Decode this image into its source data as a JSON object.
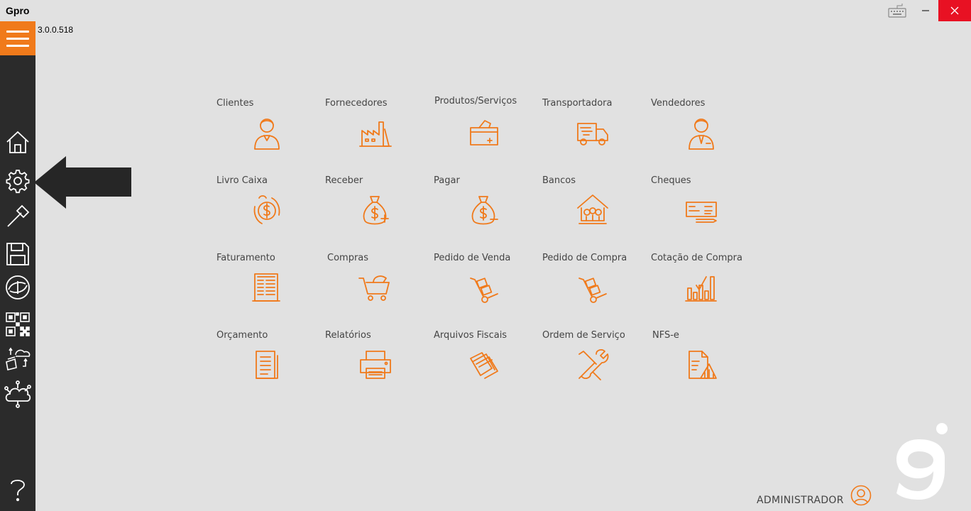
{
  "window": {
    "title": "Gpro",
    "version": "3.0.0.518"
  },
  "sidebar": {
    "items": [
      {
        "name": "home-icon"
      },
      {
        "name": "gear-icon"
      },
      {
        "name": "hammer-icon"
      },
      {
        "name": "save-icon"
      },
      {
        "name": "sync-logo-icon"
      },
      {
        "name": "qr-code-icon"
      },
      {
        "name": "cloud-sync-icon"
      },
      {
        "name": "cloud-network-icon"
      },
      {
        "name": "help-icon"
      }
    ]
  },
  "modules": [
    {
      "label": "Clientes",
      "icon": "person-icon"
    },
    {
      "label": "Fornecedores",
      "icon": "factory-icon"
    },
    {
      "label": "Produtos/Serviços",
      "icon": "box-icon"
    },
    {
      "label": "Transportadora",
      "icon": "truck-icon"
    },
    {
      "label": "Vendedores",
      "icon": "salesperson-icon"
    },
    {
      "label": "Livro Caixa",
      "icon": "cash-cycle-icon"
    },
    {
      "label": "Receber",
      "icon": "money-bag-plus-icon"
    },
    {
      "label": "Pagar",
      "icon": "money-bag-minus-icon"
    },
    {
      "label": "Bancos",
      "icon": "bank-icon"
    },
    {
      "label": "Cheques",
      "icon": "check-icon"
    },
    {
      "label": "Faturamento",
      "icon": "invoice-icon"
    },
    {
      "label": "Compras",
      "icon": "shopping-cart-icon"
    },
    {
      "label": "Pedido de Venda",
      "icon": "hand-truck-icon"
    },
    {
      "label": "Pedido de Compra",
      "icon": "hand-truck-icon"
    },
    {
      "label": "Cotação de Compra",
      "icon": "bar-chart-check-icon"
    },
    {
      "label": "Orçamento",
      "icon": "document-list-icon"
    },
    {
      "label": "Relatórios",
      "icon": "printer-icon"
    },
    {
      "label": "Arquivos Fiscais",
      "icon": "files-icon"
    },
    {
      "label": "Ordem de Serviço",
      "icon": "tools-icon"
    },
    {
      "label": "NFS-e",
      "icon": "document-chart-icon"
    }
  ],
  "user": {
    "name": "ADMINISTRADOR"
  },
  "colors": {
    "accent": "#f07a1b",
    "sidebar": "#2b2b2b",
    "background": "#e1e1e1",
    "close": "#e81123"
  }
}
